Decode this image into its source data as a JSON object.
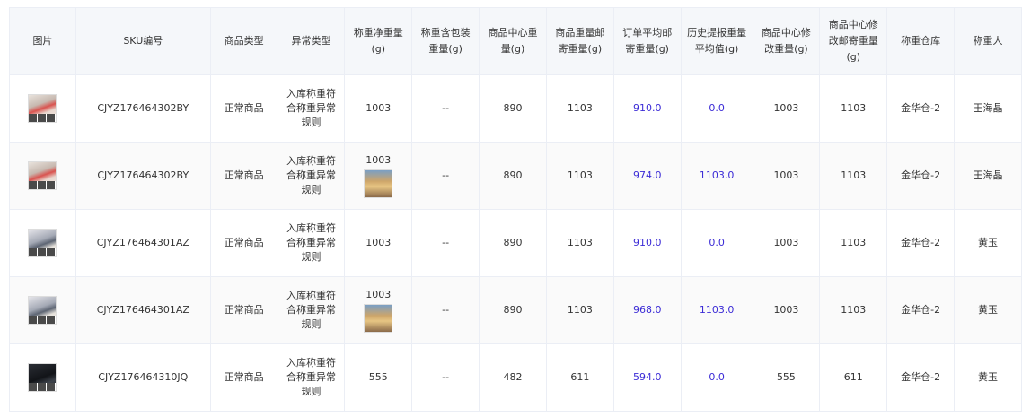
{
  "columns": [
    "图片",
    "SKU编号",
    "商品类型",
    "异常类型",
    "称重净重量(g)",
    "称重含包装重量(g)",
    "商品中心重量(g)",
    "商品重量邮寄重量(g)",
    "订单平均邮寄重量(g)",
    "历史提报重量平均值(g)",
    "商品中心修改重量(g)",
    "商品中心修改邮寄重量(g)",
    "称重仓库",
    "称重人"
  ],
  "rows": [
    {
      "sku": "CJYZ176464302BY",
      "type": "正常商品",
      "abnormal": "入库称重符合称重异常规则",
      "net_weight": "1003",
      "package_weight": "--",
      "center_weight": "890",
      "mail_weight": "1103",
      "order_avg": "910.0",
      "history_avg": "0.0",
      "mod_weight": "1003",
      "mod_mail_weight": "1103",
      "warehouse": "金华仓-2",
      "weigher": "王海晶",
      "image": "product-thumb-icon",
      "has_photo": false
    },
    {
      "sku": "CJYZ176464302BY",
      "type": "正常商品",
      "abnormal": "入库称重符合称重异常规则",
      "net_weight": "1003",
      "package_weight": "--",
      "center_weight": "890",
      "mail_weight": "1103",
      "order_avg": "974.0",
      "history_avg": "1103.0",
      "mod_weight": "1003",
      "mod_mail_weight": "1103",
      "warehouse": "金华仓-2",
      "weigher": "王海晶",
      "image": "product-thumb-icon",
      "has_photo": true
    },
    {
      "sku": "CJYZ176464301AZ",
      "type": "正常商品",
      "abnormal": "入库称重符合称重异常规则",
      "net_weight": "1003",
      "package_weight": "--",
      "center_weight": "890",
      "mail_weight": "1103",
      "order_avg": "910.0",
      "history_avg": "0.0",
      "mod_weight": "1003",
      "mod_mail_weight": "1103",
      "warehouse": "金华仓-2",
      "weigher": "黄玉",
      "image": "product-thumb-icon",
      "has_photo": false
    },
    {
      "sku": "CJYZ176464301AZ",
      "type": "正常商品",
      "abnormal": "入库称重符合称重异常规则",
      "net_weight": "1003",
      "package_weight": "--",
      "center_weight": "890",
      "mail_weight": "1103",
      "order_avg": "968.0",
      "history_avg": "1103.0",
      "mod_weight": "1003",
      "mod_mail_weight": "1103",
      "warehouse": "金华仓-2",
      "weigher": "黄玉",
      "image": "product-thumb-icon",
      "has_photo": true
    },
    {
      "sku": "CJYZ176464310JQ",
      "type": "正常商品",
      "abnormal": "入库称重符合称重异常规则",
      "net_weight": "555",
      "package_weight": "--",
      "center_weight": "482",
      "mail_weight": "611",
      "order_avg": "594.0",
      "history_avg": "0.0",
      "mod_weight": "555",
      "mod_mail_weight": "611",
      "warehouse": "金华仓-2",
      "weigher": "黄玉",
      "image": "product-thumb-icon",
      "has_photo": false
    }
  ],
  "colors": {
    "link": "#3b2bd6",
    "header_bg": "#f5f7fa",
    "border": "#ebeef5"
  }
}
